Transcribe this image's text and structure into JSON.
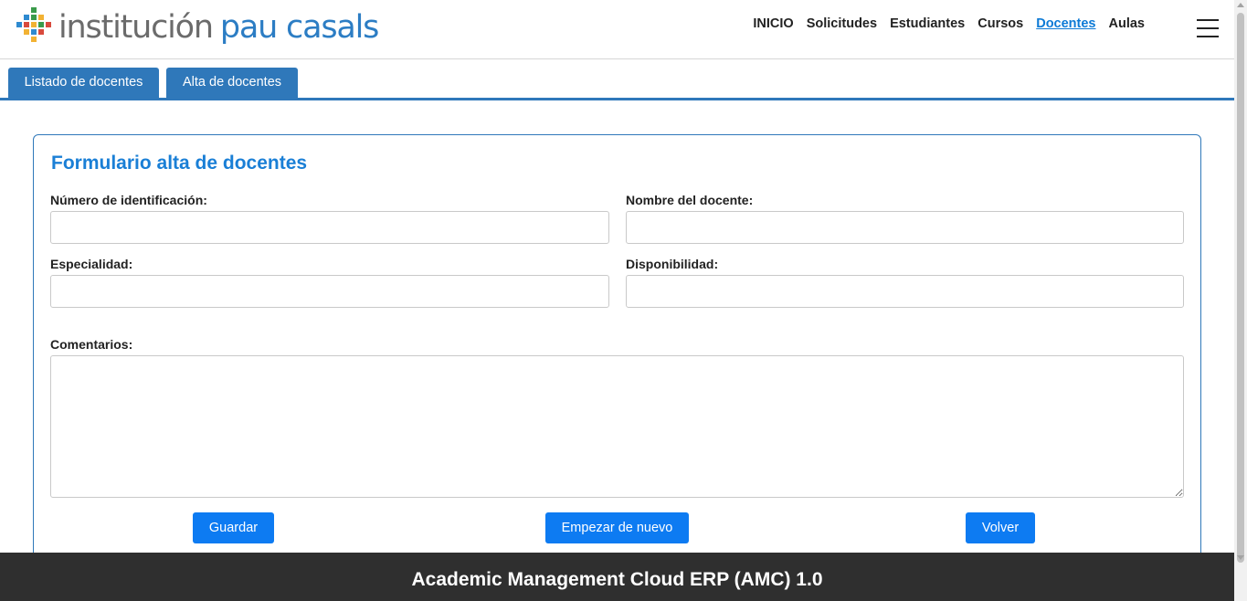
{
  "logo": {
    "word1": "institución",
    "word2": "pau casals"
  },
  "nav": {
    "items": [
      {
        "label": "INICIO"
      },
      {
        "label": "Solicitudes"
      },
      {
        "label": "Estudiantes"
      },
      {
        "label": "Cursos"
      },
      {
        "label": "Docentes",
        "active": true
      },
      {
        "label": "Aulas"
      }
    ]
  },
  "tabs": [
    {
      "label": "Listado de docentes"
    },
    {
      "label": "Alta de docentes"
    }
  ],
  "form": {
    "title": "Formulario alta de docentes",
    "fields": {
      "id_label": "Número de identificación:",
      "name_label": "Nombre del docente:",
      "specialty_label": "Especialidad:",
      "availability_label": "Disponibilidad:",
      "comments_label": "Comentarios:"
    },
    "values": {
      "id": "",
      "name": "",
      "specialty": "",
      "availability": "",
      "comments": ""
    },
    "buttons": {
      "save": "Guardar",
      "reset": "Empezar de nuevo",
      "back": "Volver"
    }
  },
  "footer": {
    "text": "Academic Management Cloud ERP (AMC) 1.0"
  },
  "colors": {
    "primary": "#2f78ba",
    "button": "#0d7bf2",
    "title": "#1a7fd6",
    "footer": "#2f2f2f",
    "active_nav": "#0d7ad6"
  }
}
